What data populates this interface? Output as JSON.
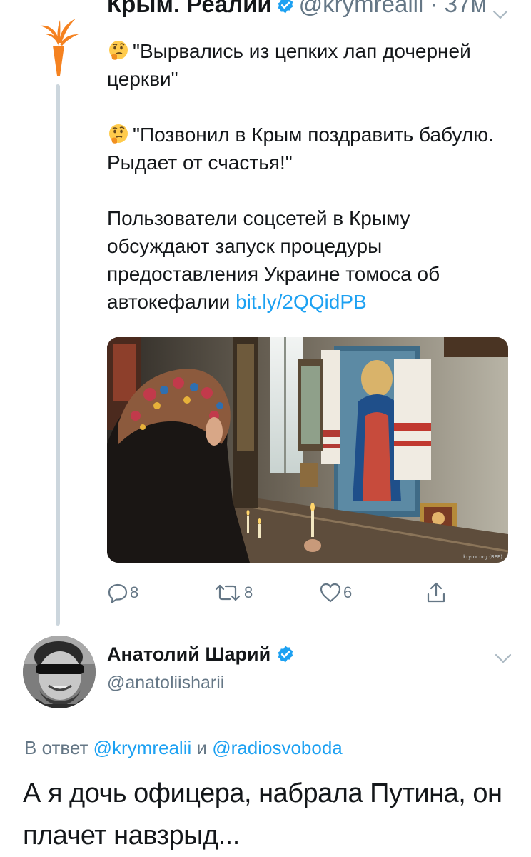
{
  "parent_tweet": {
    "author_name": "Крым. Реалии",
    "author_handle": "@krymrealii",
    "time": "37м",
    "line1": "\"Вырвались из цепких лап дочерней церкви\"",
    "line2": "\"Позвонил в Крым поздравить бабулю. Рыдает от счастья!\"",
    "body": "Пользователи соцсетей в Крыму обсуждают запуск процедуры предоставления Украине томоса об автокефалии",
    "link": "bit.ly/2QQidPB",
    "image_credit": "krymr.org (RFE)",
    "replies": "8",
    "retweets": "8",
    "likes": "6"
  },
  "reply_tweet": {
    "author_name": "Анатолий Шарий",
    "author_handle": "@anatoliisharii",
    "reply_prefix": "В ответ",
    "reply_to_1": "@krymrealii",
    "reply_conj": "и",
    "reply_to_2": "@radiosvoboda",
    "text": "А я дочь офицера, набрала Путина, он плачет навзрыд..."
  },
  "colors": {
    "link": "#1da1f2",
    "muted": "#657786",
    "text": "#14171a",
    "thread_line": "#ccd6dd",
    "logo_orange": "#f58220"
  },
  "icons": [
    "torch-logo-icon",
    "verified-badge-icon",
    "chevron-down-icon",
    "thinking-face-emoji-icon",
    "reply-icon",
    "retweet-icon",
    "like-icon",
    "share-icon"
  ]
}
